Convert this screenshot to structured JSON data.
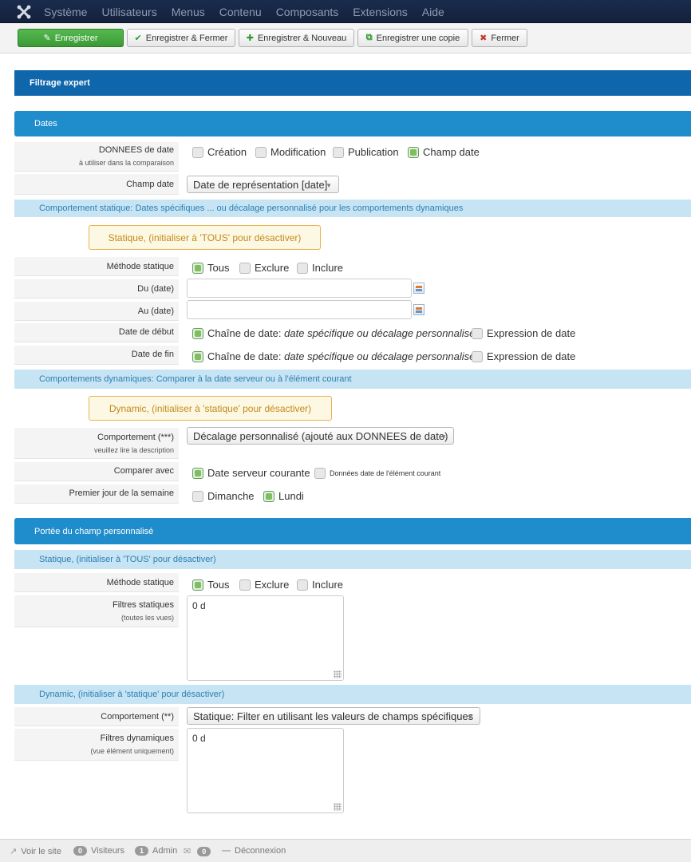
{
  "topnav": {
    "logo": "joomla-logo-icon",
    "menu": [
      "Système",
      "Utilisateurs",
      "Menus",
      "Contenu",
      "Composants",
      "Extensions",
      "Aide"
    ]
  },
  "toolbar": {
    "save": "Enregistrer",
    "save_close": "Enregistrer & Fermer",
    "save_new": "Enregistrer & Nouveau",
    "save_copy": "Enregistrer une copie",
    "close": "Fermer"
  },
  "panel_title": "Filtrage expert",
  "dates": {
    "title": "Dates",
    "donnees_label": "DONNEES de date",
    "donnees_sub": "à utiliser dans la comparaison",
    "donnees_options": [
      {
        "label": "Création",
        "checked": false
      },
      {
        "label": "Modification",
        "checked": false
      },
      {
        "label": "Publication",
        "checked": false
      },
      {
        "label": "Champ date",
        "checked": true
      }
    ],
    "champ_label": "Champ date",
    "champ_value": "Date de représentation [date]",
    "static_sub": "Comportement statique: Dates spécifiques ... ou décalage personnalisé pour les comportements dynamiques",
    "static_note": "Statique, (initialiser à 'TOUS' pour désactiver)",
    "methode_label": "Méthode statique",
    "methode_options": [
      {
        "label": "Tous",
        "checked": true
      },
      {
        "label": "Exclure",
        "checked": false
      },
      {
        "label": "Inclure",
        "checked": false
      }
    ],
    "du_label": "Du (date)",
    "du_value": "",
    "au_label": "Au (date)",
    "au_value": "",
    "debut_label": "Date de début",
    "fin_label": "Date de fin",
    "chaine_prefix": "Chaîne de date:",
    "chaine_em": "date spécifique ou décalage personnalisé",
    "expression": "Expression de date",
    "dynamic_sub": "Comportements dynamiques: Comparer à la date serveur ou à l'élément courant",
    "dynamic_note": "Dynamic, (initialiser à 'statique' pour désactiver)",
    "comportement_label": "Comportement (***)",
    "comportement_sub": "veuillez lire la description",
    "comportement_value": "Décalage personnalisé (ajouté aux DONNEES de date)",
    "comparer_label": "Comparer avec",
    "comparer_opt1": "Date serveur courante",
    "comparer_opt2": "Données date de l'élément courant",
    "premier_label": "Premier jour de la semaine",
    "premier_opt1": "Dimanche",
    "premier_opt2": "Lundi"
  },
  "portee": {
    "title": "Portée du champ personnalisé",
    "static_sub": "Statique, (initialiser à 'TOUS' pour désactiver)",
    "methode_label": "Méthode statique",
    "methode_options": [
      {
        "label": "Tous",
        "checked": true
      },
      {
        "label": "Exclure",
        "checked": false
      },
      {
        "label": "Inclure",
        "checked": false
      }
    ],
    "filtres_label": "Filtres statiques",
    "filtres_sub": "(toutes les vues)",
    "filtres_value": "0 d",
    "dynamic_sub": "Dynamic, (initialiser à 'statique' pour désactiver)",
    "comportement_label": "Comportement (**)",
    "comportement_value": "Statique: Filter en utilisant les valeurs de champs spécifiques",
    "filtres_dyn_label": "Filtres dynamiques",
    "filtres_dyn_sub": "(vue élément uniquement)",
    "filtres_dyn_value": "0 d"
  },
  "footer": {
    "voir": "Voir le site",
    "visiteurs_count": "0",
    "visiteurs": "Visiteurs",
    "admin_count": "1",
    "admin": "Admin",
    "mail_count": "0",
    "deconnexion": "Déconnexion"
  }
}
